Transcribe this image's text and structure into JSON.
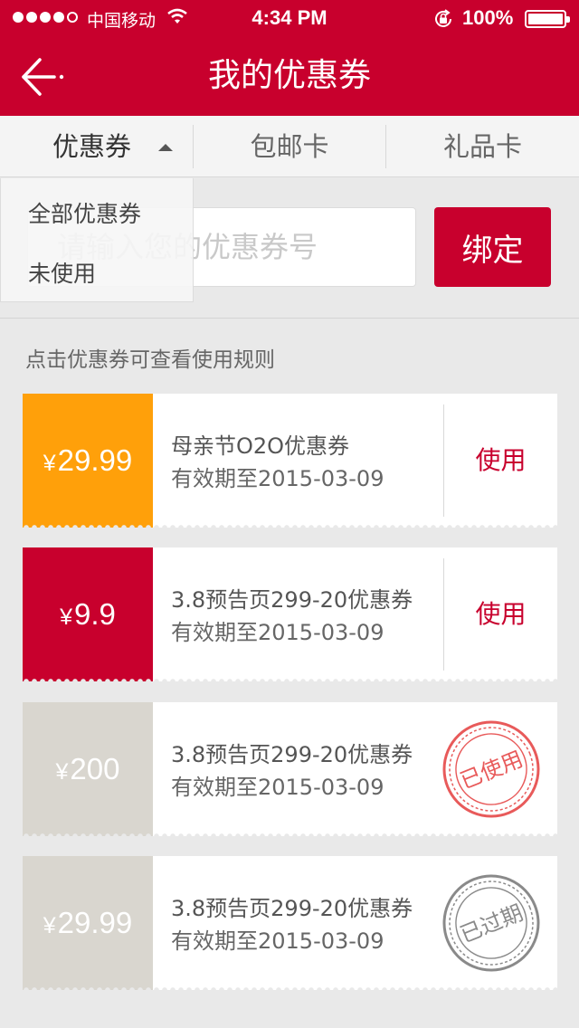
{
  "status_bar": {
    "carrier": "中国移动",
    "time": "4:34 PM",
    "battery": "100%"
  },
  "nav": {
    "title": "我的优惠券"
  },
  "tabs": [
    {
      "label": "优惠券",
      "active": true
    },
    {
      "label": "包邮卡",
      "active": false
    },
    {
      "label": "礼品卡",
      "active": false
    }
  ],
  "dropdown": {
    "items": [
      {
        "label": "全部优惠券"
      },
      {
        "label": "未使用"
      }
    ]
  },
  "bind": {
    "placeholder": "请输入您的优惠券号",
    "button_label": "绑定"
  },
  "hint": "点击优惠券可查看使用规则",
  "coupons": [
    {
      "currency": "¥",
      "amount": "29.99",
      "title": "母亲节O2O优惠券",
      "expiry": "有效期至2015-03-09",
      "state": "available",
      "action_label": "使用",
      "stub_color": "#ffa00a"
    },
    {
      "currency": "¥",
      "amount": "9.9",
      "title": "3.8预告页299-20优惠券",
      "expiry": "有效期至2015-03-09",
      "state": "available",
      "action_label": "使用",
      "stub_color": "#c8002d"
    },
    {
      "currency": "¥",
      "amount": "200",
      "title": "3.8预告页299-20优惠券",
      "expiry": "有效期至2015-03-09",
      "state": "used",
      "stamp_label": "已使用",
      "stamp_color": "#e85a5a",
      "stub_color": "#d9d6cf"
    },
    {
      "currency": "¥",
      "amount": "29.99",
      "title": "3.8预告页299-20优惠券",
      "expiry": "有效期至2015-03-09",
      "state": "expired",
      "stamp_label": "已过期",
      "stamp_color": "#8a8a8a",
      "stub_color": "#d9d6cf"
    }
  ],
  "colors": {
    "brand": "#c8002d",
    "orange": "#ffa00a",
    "grey_stub": "#d9d6cf"
  }
}
